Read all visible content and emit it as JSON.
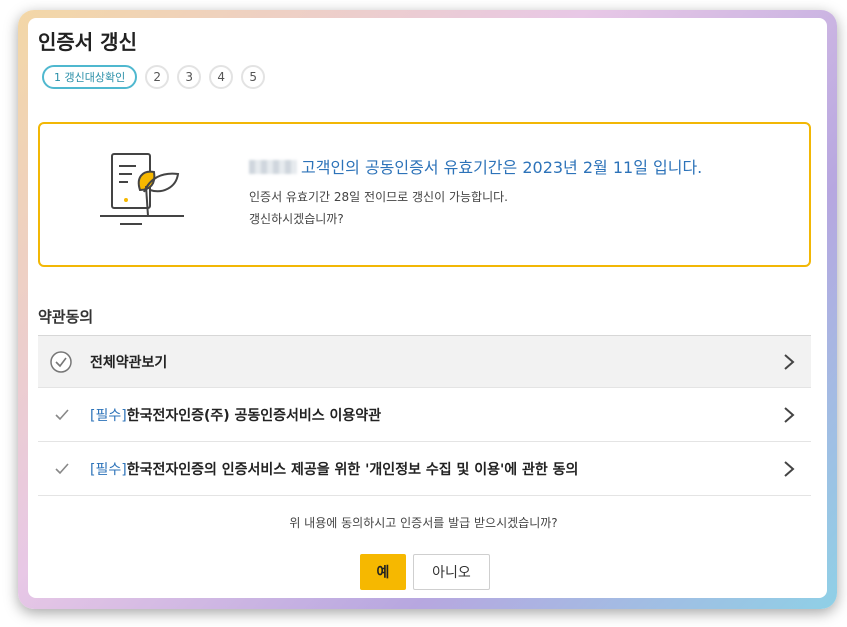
{
  "dialog": {
    "title": "인증서 갱신"
  },
  "steps": [
    "1 갱신대상확인",
    "2",
    "3",
    "4",
    "5"
  ],
  "info": {
    "headline": "고객인의 공동인증서 유효기간은 2023년 2월 11일 입니다.",
    "line1": "인증서 유효기간 28일 전이므로 갱신이 가능합니다.",
    "line2": "갱신하시겠습니까?"
  },
  "terms": {
    "section_title": "약관동의",
    "view_all": "전체약관보기",
    "items": [
      {
        "tag": "[필수]",
        "text": "한국전자인증(주) 공동인증서비스 이용약관"
      },
      {
        "tag": "[필수]",
        "text": "한국전자인증의 인증서비스 제공을 위한 '개인정보 수집 및 이용'에 관한 동의"
      }
    ]
  },
  "question": "위 내용에 동의하시고 인증서를 발급 받으시겠습니까?",
  "buttons": {
    "yes": "예",
    "no": "아니오"
  },
  "colors": {
    "accent": "#f2b705",
    "link_blue": "#2d73b9",
    "step_active": "#4fb8cf"
  }
}
